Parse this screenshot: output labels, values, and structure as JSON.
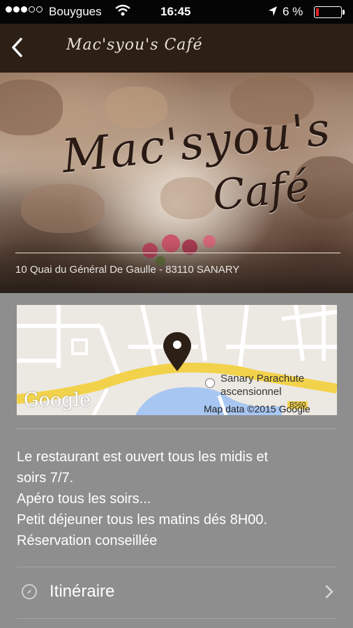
{
  "status_bar": {
    "carrier": "Bouygues",
    "time": "16:45",
    "battery_text": "6 %"
  },
  "nav": {
    "logo_text": "Mac'syou's Café"
  },
  "hero": {
    "logo_line1": "Mac'syou's",
    "logo_line2": "Café",
    "address": "10 Quai du Général De Gaulle - 83110 SANARY"
  },
  "map": {
    "poi_label_1": "Sanary Parachute",
    "poi_label_2": "ascensionnel",
    "map_data": "Map data ©2015 Google",
    "google_logo": "Google",
    "road_tag": "B560"
  },
  "description": {
    "line1": "Le restaurant est ouvert tous les midis et",
    "line2": "soirs 7/7.",
    "line3": "Apéro tous les soirs...",
    "line4": "Petit déjeuner tous les matins dés 8H00.",
    "line5": "Réservation conseillée"
  },
  "itinerary": {
    "label": "Itinéraire"
  }
}
